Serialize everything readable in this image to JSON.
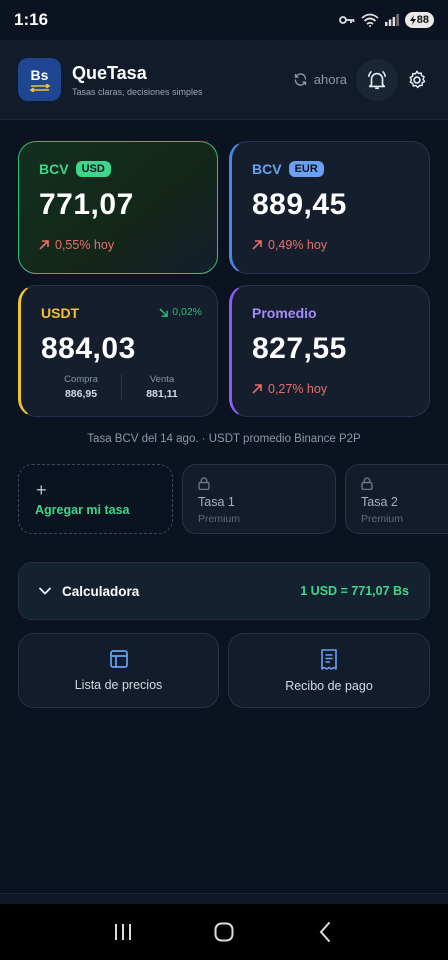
{
  "status_bar": {
    "time": "1:16",
    "battery": "88"
  },
  "header": {
    "logo_text": "Bs",
    "app_name": "QueTasa",
    "tagline": "Tasas claras, decisiones simples",
    "refresh_label": "ahora"
  },
  "cards": {
    "usd": {
      "label": "BCV",
      "chip": "USD",
      "value": "771,07",
      "change": "0,55% hoy",
      "accent": "#2fbf71"
    },
    "eur": {
      "label": "BCV",
      "chip": "EUR",
      "value": "889,45",
      "change": "0,49% hoy",
      "accent": "#4a86e8"
    },
    "usdt": {
      "label": "USDT",
      "change": "0,02%",
      "value": "884,03",
      "buy_label": "Compra",
      "buy_value": "886,95",
      "sell_label": "Venta",
      "sell_value": "881,11",
      "accent": "#f1c231"
    },
    "average": {
      "label": "Promedio",
      "value": "827,55",
      "change": "0,27% hoy",
      "accent": "#8b5cf6"
    }
  },
  "note": "Tasa BCV del 14 ago. · USDT promedio Binance P2P",
  "custom_rates": {
    "add_label": "Agregar mi tasa",
    "slots": [
      {
        "name": "Tasa 1",
        "sub": "Premium"
      },
      {
        "name": "Tasa 2",
        "sub": "Premium"
      }
    ]
  },
  "calculator": {
    "title": "Calculadora",
    "rate": "1 USD = 771,07 Bs"
  },
  "actions": {
    "prices_label": "Lista de precios",
    "receipt_label": "Recibo de pago"
  },
  "colors": {
    "background": "#0b1320",
    "positive": "#3fd68b",
    "negative": "#ec6f6a"
  }
}
